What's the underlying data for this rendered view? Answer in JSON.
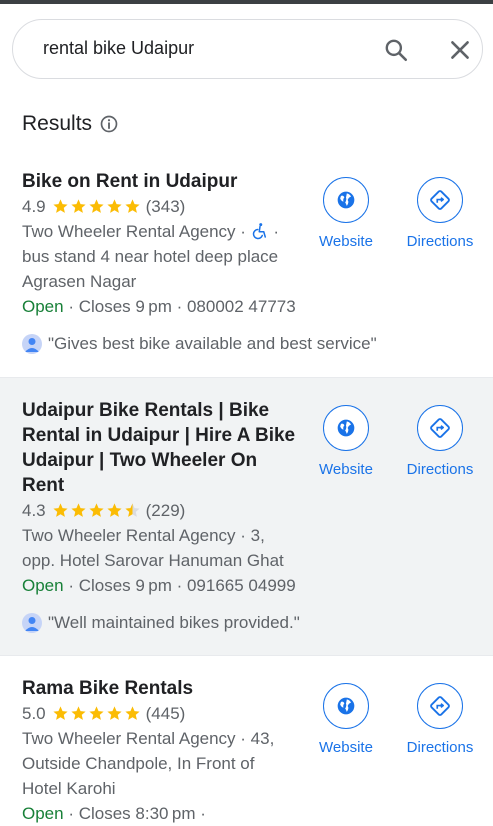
{
  "search": {
    "query": "rental bike Udaipur"
  },
  "results_header": {
    "title": "Results"
  },
  "colors": {
    "accent": "#1a73e8",
    "star": "#fbbc04",
    "open": "#188038",
    "text_muted": "#5f6368"
  },
  "listings": [
    {
      "name_lines": [
        "Bike on Rent in Udaipur"
      ],
      "rating": "4.9",
      "stars": 5,
      "reviews": "(343)",
      "category": "Two Wheeler Rental Agency ·",
      "address_lines": [
        "bus stand 4 near hotel deep place",
        "Agrasen Nagar"
      ],
      "open": "Open",
      "hours": " · Closes 9 pm · 080002 47773",
      "review": "\"Gives best bike available and best service\"",
      "website_label": "Website",
      "directions_label": "Directions"
    },
    {
      "name_lines": [
        "Udaipur Bike Rentals | Bike",
        "Rental in Udaipur | Hire A Bike",
        "Udaipur | Two Wheeler On",
        "Rent"
      ],
      "rating": "4.3",
      "stars": 4.5,
      "reviews": "(229)",
      "category": "Two Wheeler Rental Agency · 3,",
      "address_lines": [
        "opp. Hotel Sarovar Hanuman Ghat"
      ],
      "open": "Open",
      "hours": " · Closes 9 pm · 091665 04999",
      "review": "\"Well maintained bikes provided.\"",
      "website_label": "Website",
      "directions_label": "Directions"
    },
    {
      "name_lines": [
        "Rama Bike Rentals"
      ],
      "rating": "5.0",
      "stars": 5,
      "reviews": "(445)",
      "category": "Two Wheeler Rental Agency · 43,",
      "address_lines": [
        "Outside Chandpole, In Front of",
        "Hotel Karohi"
      ],
      "open": "Open",
      "hours": " · Closes 8:30 pm ·",
      "website_label": "Website",
      "directions_label": "Directions"
    }
  ]
}
